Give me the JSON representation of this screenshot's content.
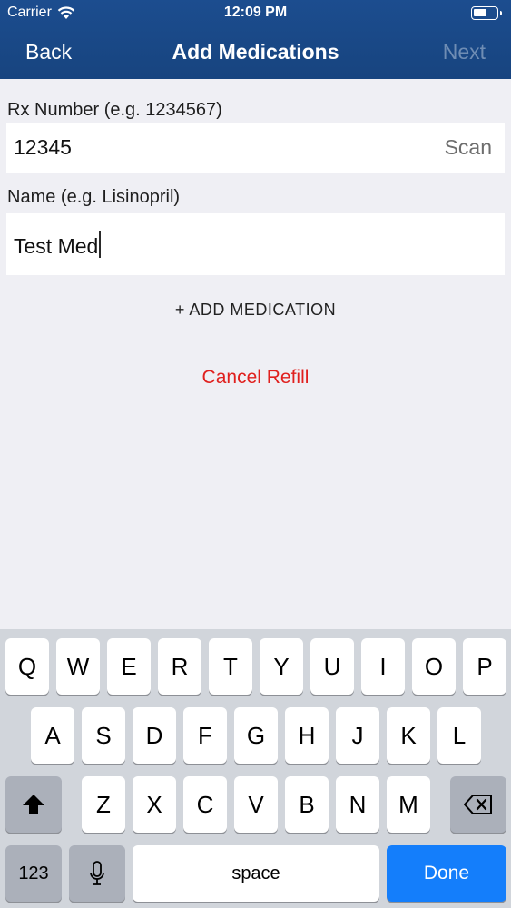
{
  "status_bar": {
    "carrier": "Carrier",
    "time": "12:09 PM"
  },
  "nav": {
    "back": "Back",
    "title": "Add Medications",
    "next": "Next"
  },
  "form": {
    "rx_label": "Rx Number (e.g. 1234567)",
    "rx_value": "12345",
    "scan_label": "Scan",
    "name_label": "Name (e.g. Lisinopril)",
    "name_value": "Test Med"
  },
  "actions": {
    "add_medication": "+ ADD  MEDICATION",
    "cancel_refill": "Cancel Refill"
  },
  "keyboard": {
    "row1": [
      "Q",
      "W",
      "E",
      "R",
      "T",
      "Y",
      "U",
      "I",
      "O",
      "P"
    ],
    "row2": [
      "A",
      "S",
      "D",
      "F",
      "G",
      "H",
      "J",
      "K",
      "L"
    ],
    "row3": [
      "Z",
      "X",
      "C",
      "V",
      "B",
      "N",
      "M"
    ],
    "numbers": "123",
    "space": "space",
    "done": "Done"
  },
  "icons": [
    "wifi-icon",
    "battery-icon",
    "shift-icon",
    "backspace-icon",
    "microphone-icon"
  ]
}
